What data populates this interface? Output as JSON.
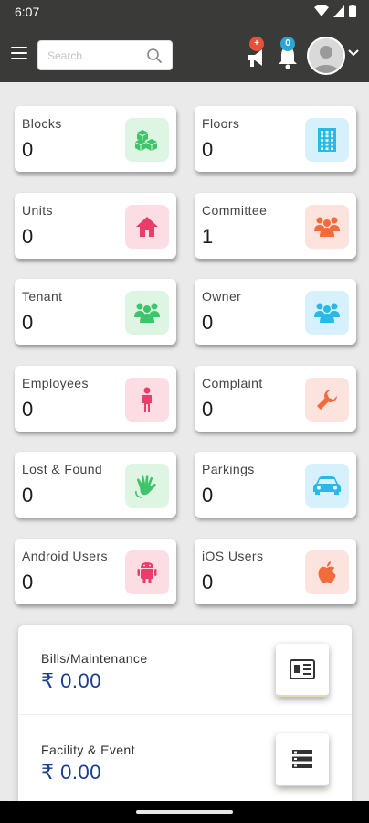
{
  "status_bar": {
    "time": "6:07"
  },
  "search": {
    "placeholder": "Search.."
  },
  "notifications": {
    "alert_badge": "+",
    "bell_badge": "0",
    "alert_color": "#e9503a",
    "bell_color": "#2aa7d6"
  },
  "stats": [
    {
      "key": "blocks",
      "label": "Blocks",
      "value": "0",
      "icon": "cubes-icon",
      "bg": "#dff5e3",
      "fg": "#3cc56a"
    },
    {
      "key": "floors",
      "label": "Floors",
      "value": "0",
      "icon": "building-icon",
      "bg": "#d6f1fb",
      "fg": "#29b8e8"
    },
    {
      "key": "units",
      "label": "Units",
      "value": "0",
      "icon": "home-icon",
      "bg": "#fbdde3",
      "fg": "#ea3d6a"
    },
    {
      "key": "committee",
      "label": "Committee",
      "value": "1",
      "icon": "group-icon",
      "bg": "#fde3dd",
      "fg": "#f26b3a"
    },
    {
      "key": "tenant",
      "label": "Tenant",
      "value": "0",
      "icon": "group-icon",
      "bg": "#dff5e3",
      "fg": "#3cc56a"
    },
    {
      "key": "owner",
      "label": "Owner",
      "value": "0",
      "icon": "group-icon",
      "bg": "#d6f1fb",
      "fg": "#29b8e8"
    },
    {
      "key": "employees",
      "label": "Employees",
      "value": "0",
      "icon": "person-icon",
      "bg": "#fbdde3",
      "fg": "#ea3d6a"
    },
    {
      "key": "complaint",
      "label": "Complaint",
      "value": "0",
      "icon": "wrench-icon",
      "bg": "#fde3dd",
      "fg": "#f26b3a"
    },
    {
      "key": "lost_found",
      "label": "Lost & Found",
      "value": "0",
      "icon": "hand-icon",
      "bg": "#dff5e3",
      "fg": "#3cc56a"
    },
    {
      "key": "parkings",
      "label": "Parkings",
      "value": "0",
      "icon": "car-icon",
      "bg": "#d6f1fb",
      "fg": "#29b8e8"
    },
    {
      "key": "android_users",
      "label": "Android Users",
      "value": "0",
      "icon": "android-icon",
      "bg": "#fbdde3",
      "fg": "#ea3d6a"
    },
    {
      "key": "ios_users",
      "label": "iOS Users",
      "value": "0",
      "icon": "apple-icon",
      "bg": "#fde3dd",
      "fg": "#f26b3a"
    }
  ],
  "summary": {
    "bills": {
      "label": "Bills/Maintenance",
      "amount": "₹ 0.00",
      "icon": "receipt-icon"
    },
    "facility": {
      "label": "Facility & Event",
      "amount": "₹ 0.00",
      "icon": "list-icon"
    }
  }
}
